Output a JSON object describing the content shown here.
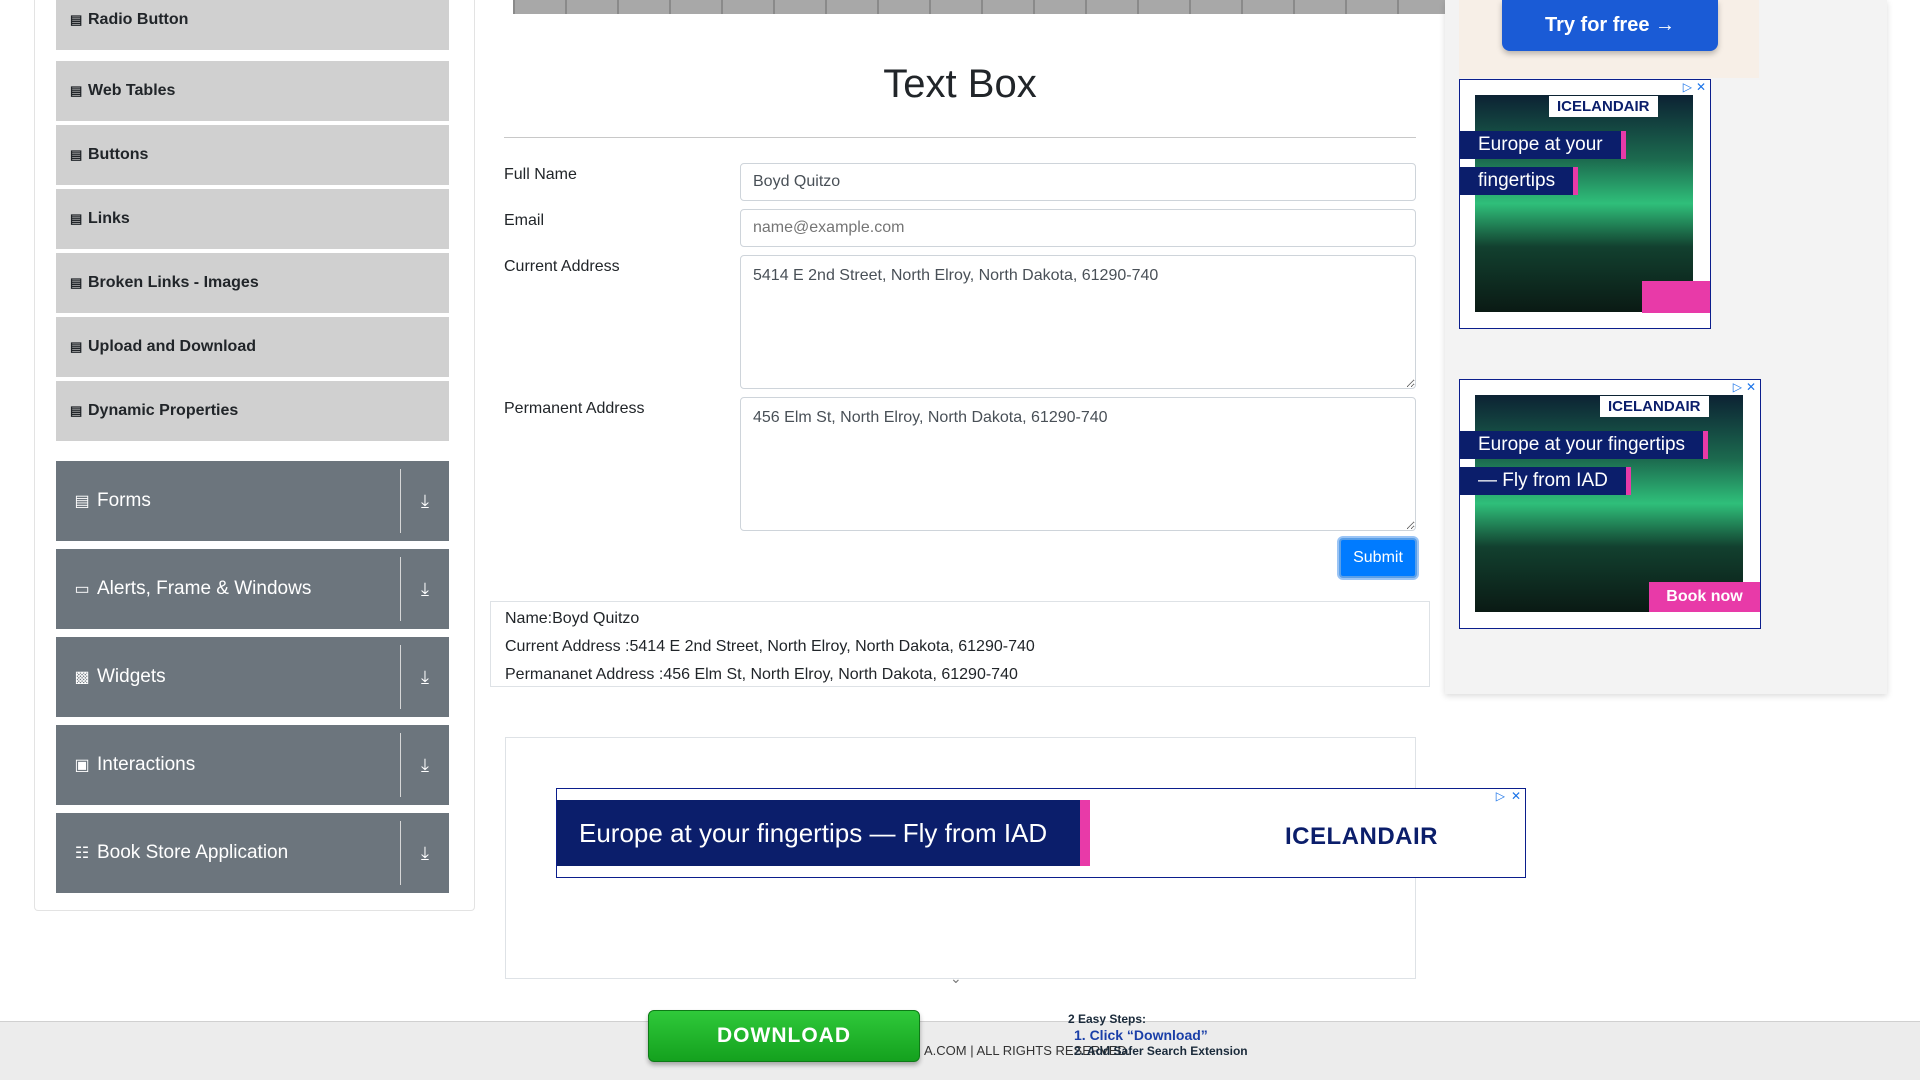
{
  "sidebar": {
    "sub_items": [
      {
        "label": "Radio Button"
      },
      {
        "label": "Web Tables"
      },
      {
        "label": "Buttons"
      },
      {
        "label": "Links"
      },
      {
        "label": "Broken Links - Images"
      },
      {
        "label": "Upload and Download"
      },
      {
        "label": "Dynamic Properties"
      }
    ],
    "groups": [
      {
        "label": "Forms",
        "icon": "document-icon"
      },
      {
        "label": "Alerts, Frame & Windows",
        "icon": "window-icon"
      },
      {
        "label": "Widgets",
        "icon": "widgets-icon"
      },
      {
        "label": "Interactions",
        "icon": "interactions-icon"
      },
      {
        "label": "Book Store Application",
        "icon": "books-icon"
      }
    ]
  },
  "main": {
    "title": "Text Box",
    "form": {
      "full_name_label": "Full Name",
      "full_name_value": "Boyd Quitzo",
      "email_label": "Email",
      "email_placeholder": "name@example.com",
      "current_address_label": "Current Address",
      "current_address_value": "5414 E 2nd Street, North Elroy, North Dakota, 61290-740",
      "permanent_address_label": "Permanent Address",
      "permanent_address_value": "456 Elm St, North Elroy, North Dakota, 61290-740",
      "submit_label": "Submit"
    },
    "output": {
      "name": "Name:Boyd Quitzo",
      "current_address": "Current Address :5414 E 2nd Street, North Elroy, North Dakota, 61290-740",
      "permanent_address": "Permananet Address :456 Elm St, North Elroy, North Dakota, 61290-740"
    }
  },
  "ads": {
    "try_label": "Try for free →",
    "brand": "ICELANDAIR",
    "ad1_line1": "Europe at your",
    "ad1_line2": "fingertips",
    "ad2_line1": "Europe at your fingertips",
    "ad2_line2": "— Fly from IAD",
    "ad2_book": "Book now",
    "banner_text": "Europe at your fingertips — Fly from IAD"
  },
  "footer": {
    "text": "A.COM | ALL RIGHTS RESERVED.",
    "download_label": "DOWNLOAD",
    "steps_title": "2 Easy Steps:",
    "step1": "1. Click “Download”",
    "step2": "2. Add Safer Search Extension"
  },
  "colors": {
    "accent": "#007bff",
    "sidebar_group": "#6c757d",
    "sidebar_item": "#d0d0d0"
  }
}
